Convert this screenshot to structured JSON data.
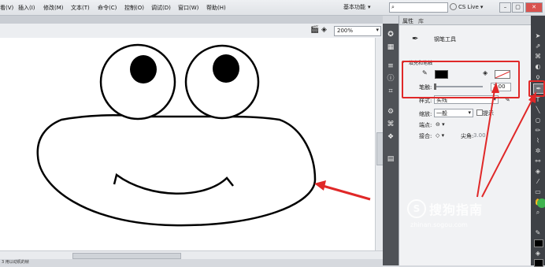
{
  "menubar": {
    "items": [
      "看(V)",
      "插入(I)",
      "修改(M)",
      "文本(T)",
      "命令(C)",
      "控制(O)",
      "调试(D)",
      "窗口(W)",
      "帮助(H)"
    ],
    "workspace_label": "基本功能",
    "search_placeholder": "",
    "cslive_label": "CS Live",
    "win_buttons": [
      "–",
      "▢",
      "✕"
    ]
  },
  "doc": {
    "zoom_value": "200%",
    "status_text": "3 用以动机的帧"
  },
  "props_panel": {
    "tabs": [
      "属性",
      "库"
    ],
    "tool_name": "钢笔工具",
    "section_title": "填充和笔触",
    "stroke_label": "笔触:",
    "stroke_value": "2.00",
    "style_label": "样式:",
    "style_value": "实线",
    "scale_label": "缩放:",
    "scale_value": "一般",
    "hint_label": "提示",
    "cap_label": "端点:",
    "join_label": "接合:",
    "sharp_label": "尖角:",
    "sharp_value": "3.00",
    "stroke_color": "#000000",
    "fill_color": "none"
  },
  "watermark": {
    "brand": "搜狗指南",
    "url": "zhinan.sogou.com"
  },
  "colors": {
    "accent_red": "#e02828",
    "tool_bg": "#3e4146",
    "dock_bg": "#4f5257"
  }
}
